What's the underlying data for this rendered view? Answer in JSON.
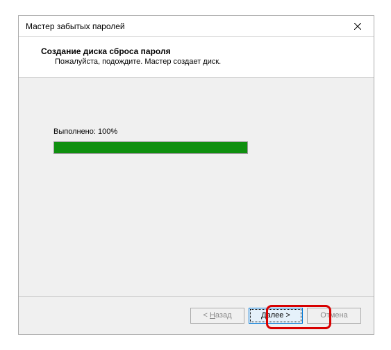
{
  "titlebar": {
    "title": "Мастер забытых паролей"
  },
  "header": {
    "title": "Создание диска сброса пароля",
    "subtitle": "Пожалуйста, подождите. Мастер создает диск."
  },
  "content": {
    "progress_label": "Выполнено: 100%"
  },
  "footer": {
    "back_prefix": "< ",
    "back_u": "Н",
    "back_rest": "азад",
    "next_u": "Д",
    "next_rest": "алее >",
    "cancel_label": "Отмена"
  }
}
